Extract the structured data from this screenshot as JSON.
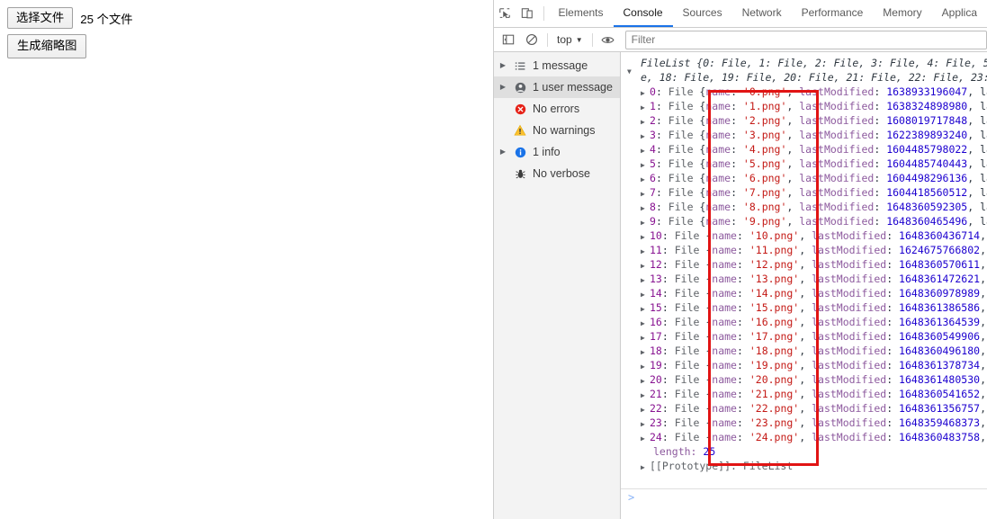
{
  "page": {
    "choose_file_button": "选择文件",
    "file_count_label": "25 个文件",
    "generate_thumb_button": "生成缩略图"
  },
  "devtools": {
    "toolbar_icons": [
      {
        "name": "inspect-element-icon"
      },
      {
        "name": "device-toolbar-icon"
      }
    ],
    "tabs": [
      {
        "label": "Elements",
        "active": false
      },
      {
        "label": "Console",
        "active": true
      },
      {
        "label": "Sources",
        "active": false
      },
      {
        "label": "Network",
        "active": false
      },
      {
        "label": "Performance",
        "active": false
      },
      {
        "label": "Memory",
        "active": false
      },
      {
        "label": "Applica",
        "active": false
      }
    ],
    "filter_bar": {
      "sidebar_toggle_icon": "console-sidebar-toggle-icon",
      "clear_console_icon": "clear-console-icon",
      "context_selector": "top",
      "context_chevron": "▼",
      "eye_icon": "live-expression-eye-icon",
      "filter_placeholder": "Filter",
      "filter_value": ""
    },
    "sidebar": {
      "items": [
        {
          "label": "1 message",
          "icon": "list-icon",
          "arrow": true,
          "selected": false
        },
        {
          "label": "1 user message",
          "icon": "user-icon",
          "arrow": true,
          "selected": true
        },
        {
          "label": "No errors",
          "icon": "error-icon",
          "arrow": false,
          "selected": false
        },
        {
          "label": "No warnings",
          "icon": "warning-icon",
          "arrow": false,
          "selected": false
        },
        {
          "label": "1 info",
          "icon": "info-icon",
          "arrow": true,
          "selected": false
        },
        {
          "label": "No verbose",
          "icon": "bug-icon",
          "arrow": false,
          "selected": false
        }
      ]
    },
    "console": {
      "header_line_1": "FileList {0: File, 1: File, 2: File, 3: File, 4: File, 5:",
      "header_line_2": "e, 18: File, 19: File, 20: File, 21: File, 22: File, 23:",
      "rows": [
        {
          "index": "0",
          "ctor": "File",
          "name": "'0.png'",
          "lastModified": "1638933196047",
          "tail": ", la"
        },
        {
          "index": "1",
          "ctor": "File",
          "name": "'1.png'",
          "lastModified": "1638324898980",
          "tail": ", la"
        },
        {
          "index": "2",
          "ctor": "File",
          "name": "'2.png'",
          "lastModified": "1608019717848",
          "tail": ", la"
        },
        {
          "index": "3",
          "ctor": "File",
          "name": "'3.png'",
          "lastModified": "1622389893240",
          "tail": ", la"
        },
        {
          "index": "4",
          "ctor": "File",
          "name": "'4.png'",
          "lastModified": "1604485798022",
          "tail": ", la"
        },
        {
          "index": "5",
          "ctor": "File",
          "name": "'5.png'",
          "lastModified": "1604485740443",
          "tail": ", la"
        },
        {
          "index": "6",
          "ctor": "File",
          "name": "'6.png'",
          "lastModified": "1604498296136",
          "tail": ", la"
        },
        {
          "index": "7",
          "ctor": "File",
          "name": "'7.png'",
          "lastModified": "1604418560512",
          "tail": ", la"
        },
        {
          "index": "8",
          "ctor": "File",
          "name": "'8.png'",
          "lastModified": "1648360592305",
          "tail": ", la"
        },
        {
          "index": "9",
          "ctor": "File",
          "name": "'9.png'",
          "lastModified": "1648360465496",
          "tail": ", la"
        },
        {
          "index": "10",
          "ctor": "File",
          "name": "'10.png'",
          "lastModified": "1648360436714",
          "tail": ","
        },
        {
          "index": "11",
          "ctor": "File",
          "name": "'11.png'",
          "lastModified": "1624675766802",
          "tail": ","
        },
        {
          "index": "12",
          "ctor": "File",
          "name": "'12.png'",
          "lastModified": "1648360570611",
          "tail": ","
        },
        {
          "index": "13",
          "ctor": "File",
          "name": "'13.png'",
          "lastModified": "1648361472621",
          "tail": ","
        },
        {
          "index": "14",
          "ctor": "File",
          "name": "'14.png'",
          "lastModified": "1648360978989",
          "tail": ","
        },
        {
          "index": "15",
          "ctor": "File",
          "name": "'15.png'",
          "lastModified": "1648361386586",
          "tail": ","
        },
        {
          "index": "16",
          "ctor": "File",
          "name": "'16.png'",
          "lastModified": "1648361364539",
          "tail": ","
        },
        {
          "index": "17",
          "ctor": "File",
          "name": "'17.png'",
          "lastModified": "1648360549906",
          "tail": ","
        },
        {
          "index": "18",
          "ctor": "File",
          "name": "'18.png'",
          "lastModified": "1648360496180",
          "tail": ","
        },
        {
          "index": "19",
          "ctor": "File",
          "name": "'19.png'",
          "lastModified": "1648361378734",
          "tail": ","
        },
        {
          "index": "20",
          "ctor": "File",
          "name": "'20.png'",
          "lastModified": "1648361480530",
          "tail": ","
        },
        {
          "index": "21",
          "ctor": "File",
          "name": "'21.png'",
          "lastModified": "1648360541652",
          "tail": ","
        },
        {
          "index": "22",
          "ctor": "File",
          "name": "'22.png'",
          "lastModified": "1648361356757",
          "tail": ","
        },
        {
          "index": "23",
          "ctor": "File",
          "name": "'23.png'",
          "lastModified": "1648359468373",
          "tail": ","
        },
        {
          "index": "24",
          "ctor": "File",
          "name": "'24.png'",
          "lastModified": "1648360483758",
          "tail": ","
        }
      ],
      "length_label": "length:",
      "length_value": "25",
      "prototype_label": "[[Prototype]]:",
      "prototype_value": "FileList",
      "prompt_symbol": ">"
    },
    "annotation": {
      "name": "red-highlight-rectangle",
      "color": "#e11414"
    }
  }
}
